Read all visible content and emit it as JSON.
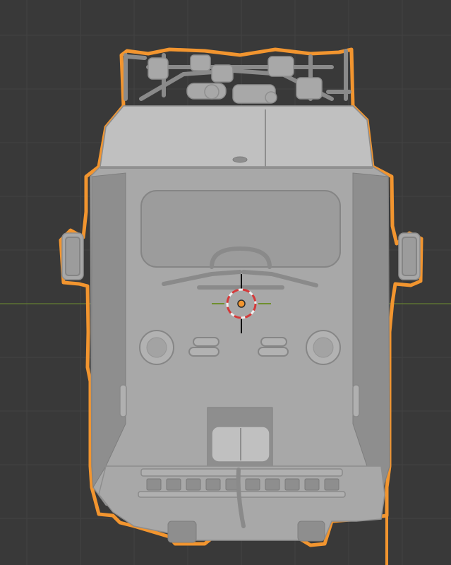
{
  "viewport": {
    "mode": "front-orthographic",
    "background_color": "#393939",
    "grid_color": "#434343",
    "grid_major_color": "#3f3f3f",
    "x_axis_color": "#6f8f2e",
    "z_axis_color": "#2a6fc4",
    "selection_outline_color": "#f2952f",
    "model_color": "#a8a8a8",
    "model_shadow_color": "#8e8e8e",
    "model_highlight_color": "#c0c0c0",
    "cursor": {
      "ring_red": "#d43a3a",
      "ring_white": "#f0f0f0",
      "origin_color": "#f2952f"
    }
  },
  "object": {
    "name": "locomotive-front",
    "selected": true
  }
}
